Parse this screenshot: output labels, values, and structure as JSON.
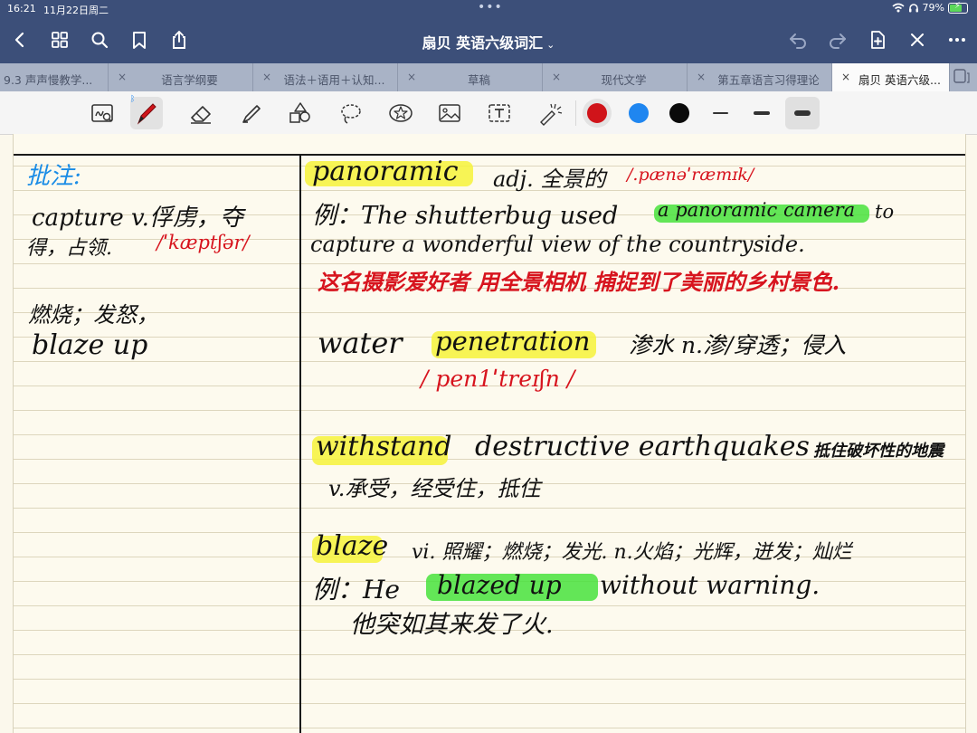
{
  "status": {
    "time": "16:21",
    "date": "11月22日周二",
    "battery": "79%",
    "battery_level": 0.79,
    "dots": "•••"
  },
  "nav": {
    "title": "扇贝 英语六级词汇",
    "title_chevron": "⌄"
  },
  "tabs": [
    {
      "label": "9.3 声声慢教学...",
      "active": false
    },
    {
      "label": "语言学纲要",
      "active": false
    },
    {
      "label": "语法＋语用＋认知...",
      "active": false
    },
    {
      "label": "草稿",
      "active": false
    },
    {
      "label": "现代文学",
      "active": false
    },
    {
      "label": "第五章语言习得理论",
      "active": false
    },
    {
      "label": "扇贝 英语六级...",
      "active": true
    }
  ],
  "tab_close_glyph": "×",
  "toolbar": {
    "pen_colors": [
      "#d0141a",
      "#1f86f0",
      "#0a0a0a"
    ],
    "selected_pen_color": "#d0141a",
    "bluetooth_glyph": "ᛒ"
  },
  "notes": {
    "left": {
      "heading": "批注:",
      "capture_line1": "capture  v.俘虏，夺",
      "capture_line2": "得，占领.",
      "capture_ipa": "/ˈkæptʃər/",
      "blaze_cn": "燃烧；发怒，",
      "blaze_en": "blaze  up"
    },
    "right": {
      "panoramic_word": "panoramic",
      "panoramic_def": "adj. 全景的",
      "panoramic_ipa": "/.pænəˈræmɪk/",
      "example1_prefix": "例：The  shutterbug  used",
      "example1_phrase": "a  panoramic  camera",
      "example1_suffix": "to",
      "example1_line2": "capture  a  wonderful  view  of  the  countryside.",
      "example1_translation": "这名摄影爱好者 用全景相机 捕捉到了美丽的乡村景色.",
      "water_word": "water",
      "penetration_word": "penetration",
      "penetration_cn": "渗水      n.渗/穿透；侵入",
      "penetration_ipa": "/ pen1ˈtreɪʃn /",
      "withstand_word": "withstand",
      "withstand_phrase": "destructive  earthquakes",
      "withstand_cn": "抵住破坏性的地震",
      "withstand_def": "v.承受，经受住，抵住",
      "blaze_word": "blaze",
      "blaze_def": "vi. 照耀；燃烧；发光.     n.火焰；光辉，迸发；灿烂",
      "example2_prefix": "例：He",
      "example2_phrase": "blazed  up",
      "example2_suffix": "without  warning.",
      "example2_translation": "他突如其来发了火."
    }
  }
}
